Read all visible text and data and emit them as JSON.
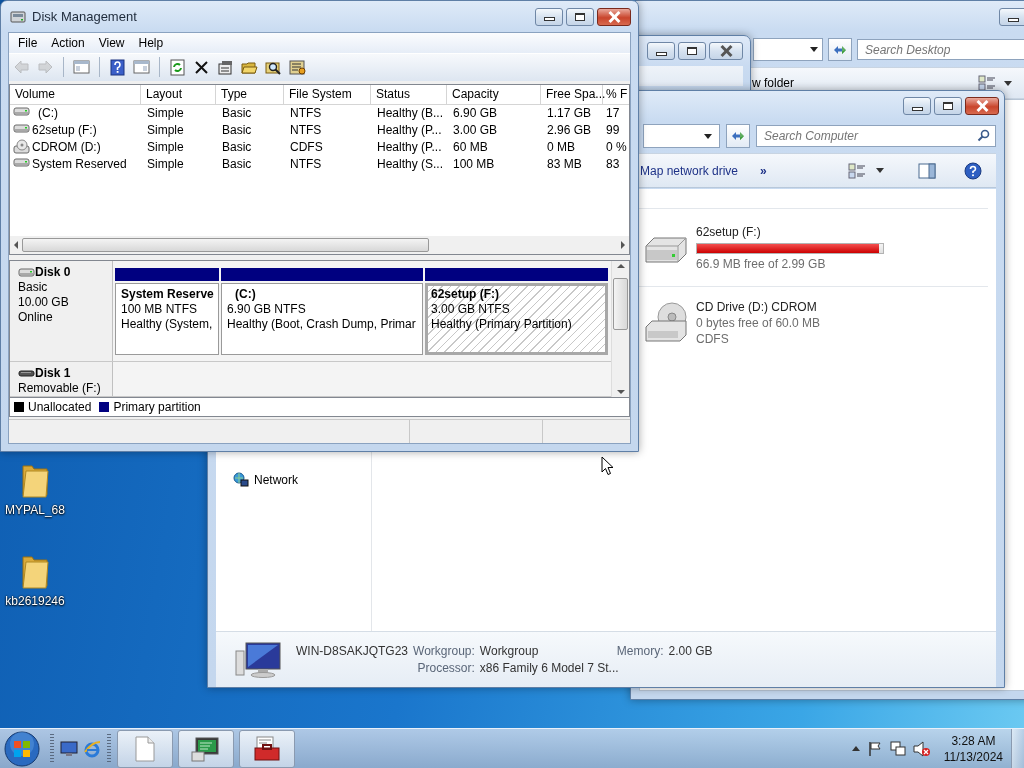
{
  "disk_management": {
    "title": "Disk Management",
    "menu": [
      "File",
      "Action",
      "View",
      "Help"
    ],
    "toolbar": [
      {
        "kind": "back",
        "disabled": true
      },
      {
        "kind": "forward",
        "disabled": true
      },
      {
        "kind": "panes",
        "disabled": false
      },
      {
        "kind": "help",
        "disabled": false
      },
      {
        "kind": "action-pane",
        "disabled": false
      },
      {
        "kind": "refresh",
        "disabled": false
      },
      {
        "kind": "delete",
        "disabled": false
      },
      {
        "kind": "properties",
        "disabled": false
      },
      {
        "kind": "open",
        "disabled": false
      },
      {
        "kind": "explore",
        "disabled": false
      },
      {
        "kind": "wizard",
        "disabled": false
      }
    ],
    "columns": [
      "Volume",
      "Layout",
      "Type",
      "File System",
      "Status",
      "Capacity",
      "Free Spa...",
      "% F"
    ],
    "rows": [
      {
        "kind": "disk",
        "cells": [
          "(C:)",
          "Simple",
          "Basic",
          "NTFS",
          "Healthy (B...",
          "6.90 GB",
          "1.17 GB",
          "17"
        ]
      },
      {
        "kind": "disk",
        "cells": [
          "62setup (F:)",
          "Simple",
          "Basic",
          "NTFS",
          "Healthy (P...",
          "3.00 GB",
          "2.96 GB",
          "99"
        ]
      },
      {
        "kind": "cd",
        "cells": [
          "CDROM (D:)",
          "Simple",
          "Basic",
          "CDFS",
          "Healthy (P...",
          "60 MB",
          "0 MB",
          "0 %"
        ]
      },
      {
        "kind": "disk",
        "cells": [
          "System Reserved",
          "Simple",
          "Basic",
          "NTFS",
          "Healthy (S...",
          "100 MB",
          "83 MB",
          "83"
        ]
      }
    ],
    "disks": [
      {
        "name": "Disk 0",
        "kind": "basic",
        "lines": [
          "Basic",
          "10.00 GB",
          "Online"
        ],
        "partitions": [
          {
            "name": "System Reserve",
            "kind": "primary",
            "size": "100 MB NTFS",
            "status": "Healthy (System,",
            "selected": false
          },
          {
            "name": "(C:)",
            "kind": "primary",
            "size": "6.90 GB NTFS",
            "status": "Healthy (Boot, Crash Dump, Primar",
            "selected": false
          },
          {
            "name": "62setup (F:)",
            "kind": "primary",
            "size": "3.00 GB NTFS",
            "status": "Healthy (Primary Partition)",
            "selected": true
          }
        ]
      },
      {
        "name": "Disk 1",
        "kind": "removable",
        "lines": [
          "Removable (F:)"
        ]
      }
    ],
    "legend": [
      {
        "label": "Unallocated",
        "color": "#000000"
      },
      {
        "label": "Primary partition",
        "color": "#000080"
      }
    ]
  },
  "desktop_window": {
    "search": {
      "placeholder": "Search Desktop"
    },
    "toolbar_text": "w folder"
  },
  "computer_window": {
    "search": {
      "placeholder": "Search Computer"
    },
    "toolbar": [
      "Map network drive",
      "»"
    ],
    "drives": [
      {
        "kind": "disk",
        "name": "62setup (F:)",
        "level": 0.98,
        "free": "66.9 MB free of 2.99 GB"
      },
      {
        "kind": "cd",
        "name": "CD Drive (D:) CDROM",
        "free": "0 bytes free of 60.0 MB",
        "file_system": "CDFS"
      }
    ],
    "nav": [
      {
        "label": "Network"
      }
    ],
    "details": {
      "computer_name": "WIN-D8SAKJQTG23",
      "fields": [
        {
          "label": "Workgroup:",
          "value": "Workgroup"
        },
        {
          "label": "Memory:",
          "value": "2.00 GB"
        },
        {
          "label": "Processor:",
          "value": "x86 Family 6 Model 7 St..."
        }
      ]
    }
  },
  "desktop_icons": [
    {
      "label": "MYPAL_68"
    },
    {
      "label": "kb2619246"
    }
  ],
  "taskbar": {
    "time": "3:28 AM",
    "date": "11/13/2024"
  }
}
